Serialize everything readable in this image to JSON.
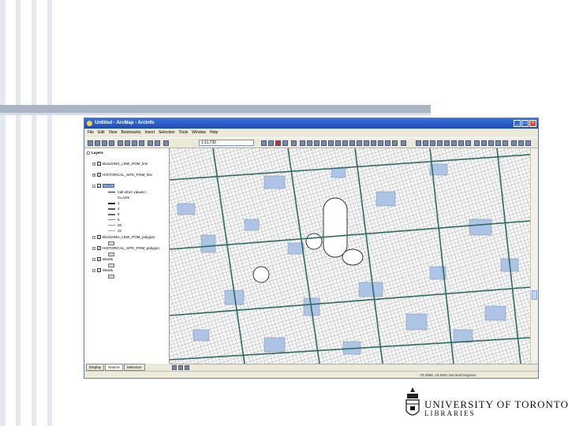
{
  "window": {
    "title": "Untitled - ArcMap - ArcInfo",
    "buttons": [
      "_",
      "□",
      "×"
    ]
  },
  "menu": [
    "File",
    "Edit",
    "View",
    "Bookmarks",
    "Insert",
    "Selection",
    "Tools",
    "Window",
    "Help"
  ],
  "toolbar": {
    "scale": "1:11,736"
  },
  "toc": {
    "root": "Layers",
    "layers": [
      {
        "name": "BUILDING_LINE_POM_line",
        "checked": true
      },
      {
        "name": "HISTORICAL_SITE_POM_line",
        "checked": true
      },
      {
        "name": "Wards",
        "checked": true,
        "selected": true
      },
      {
        "name": "BUILDING_LINE_POM_polygon",
        "checked": true
      },
      {
        "name": "HISTORICAL_SITE_POM_polygon",
        "checked": true
      },
      {
        "name": "Wards",
        "checked": true
      },
      {
        "name": "Wards",
        "checked": true
      }
    ],
    "legend": [
      "<all other values>",
      "CLASS",
      "1",
      "4",
      "5",
      "6",
      "20",
      "21"
    ]
  },
  "tabs": [
    "Display",
    "Source",
    "Selection"
  ],
  "status": "-79.3986, 43.6581 Decimal Degrees",
  "logo": {
    "line1": "UNIVERSITY OF TORONTO",
    "line2": "LIBRARIES"
  },
  "colors": {
    "accent": "#3b70d8",
    "road": "#2e6b66",
    "block": "#aec4e6",
    "bar": "#aab5c7"
  }
}
